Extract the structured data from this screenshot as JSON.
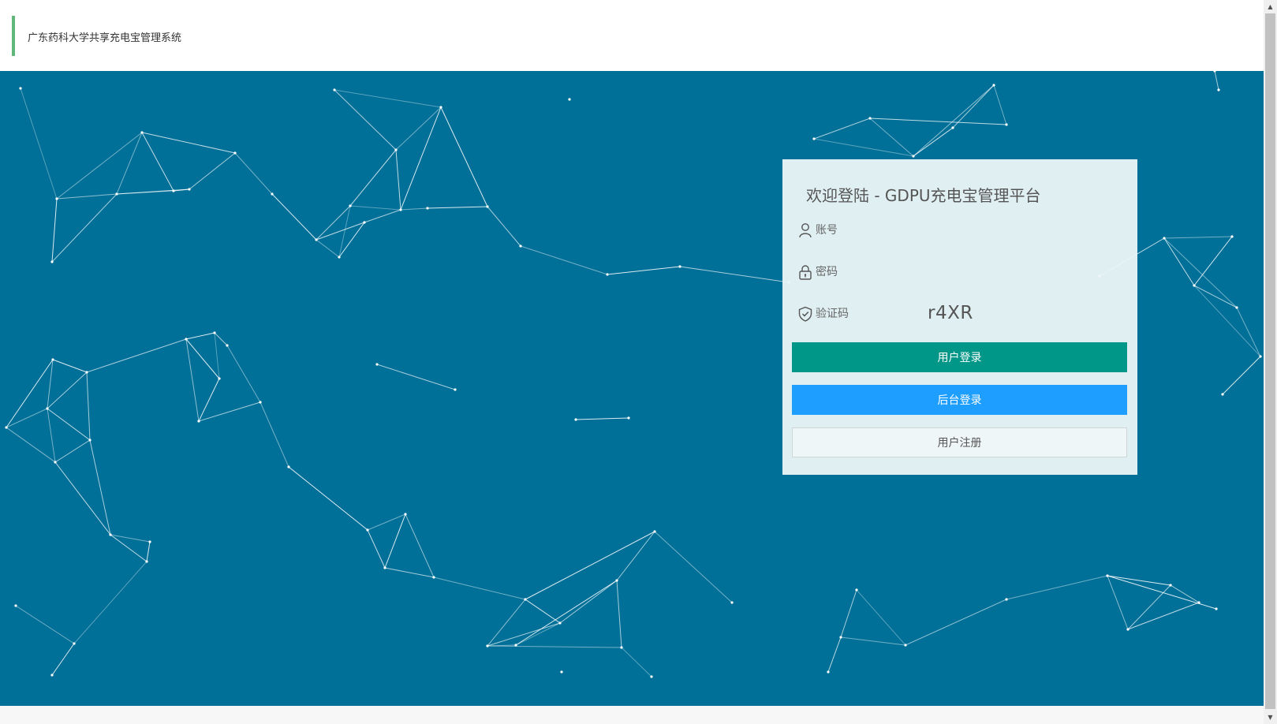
{
  "header": {
    "title": "广东药科大学共享充电宝管理系统",
    "accent_color": "#5fb878"
  },
  "background": {
    "color": "#007098",
    "pattern": "network-lines"
  },
  "login": {
    "title": "欢迎登陆 - GDPU充电宝管理平台",
    "account_placeholder": "账号",
    "password_placeholder": "密码",
    "captcha_placeholder": "验证码",
    "captcha_code": "r4XR",
    "user_login_label": "用户登录",
    "admin_login_label": "后台登录",
    "register_label": "用户注册",
    "user_login_color": "#009688",
    "admin_login_color": "#1e9fff",
    "icons": {
      "account": "user-icon",
      "password": "lock-icon",
      "captcha": "shield-check-icon"
    }
  }
}
